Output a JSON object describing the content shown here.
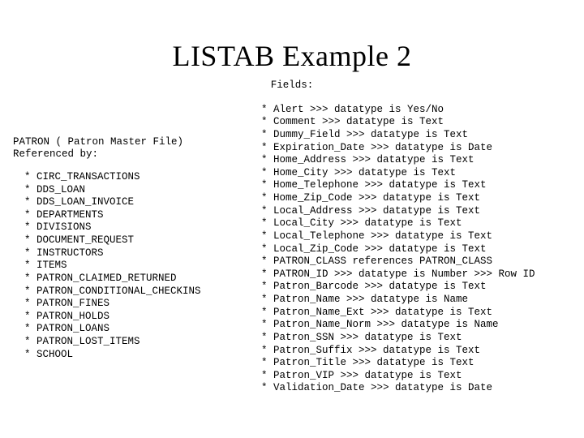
{
  "title": "LISTAB Example 2",
  "fields_label": "Fields:",
  "left": {
    "header_line1": "PATRON ( Patron Master File)",
    "header_line2": "Referenced by:",
    "items": [
      "CIRC_TRANSACTIONS",
      "DDS_LOAN",
      "DDS_LOAN_INVOICE",
      "DEPARTMENTS",
      "DIVISIONS",
      "DOCUMENT_REQUEST",
      "INSTRUCTORS",
      "ITEMS",
      "PATRON_CLAIMED_RETURNED",
      "PATRON_CONDITIONAL_CHECKINS",
      "PATRON_FINES",
      "PATRON_HOLDS",
      "PATRON_LOANS",
      "PATRON_LOST_ITEMS",
      "SCHOOL"
    ]
  },
  "right": {
    "items": [
      "Alert >>> datatype is Yes/No",
      "Comment >>> datatype is Text",
      "Dummy_Field >>> datatype is Text",
      "Expiration_Date >>> datatype is Date",
      "Home_Address >>> datatype is Text",
      "Home_City >>> datatype is Text",
      "Home_Telephone >>> datatype is Text",
      "Home_Zip_Code >>> datatype is Text",
      "Local_Address >>> datatype is Text",
      "Local_City >>> datatype is Text",
      "Local_Telephone >>> datatype is Text",
      "Local_Zip_Code >>> datatype is Text",
      "PATRON_CLASS references PATRON_CLASS",
      "PATRON_ID >>> datatype is Number >>> Row ID",
      "Patron_Barcode >>> datatype is Text",
      "Patron_Name >>> datatype is Name",
      "Patron_Name_Ext >>> datatype is Text",
      "Patron_Name_Norm >>> datatype is Name",
      "Patron_SSN >>> datatype is Text",
      "Patron_Suffix >>> datatype is Text",
      "Patron_Title >>> datatype is Text",
      "Patron_VIP >>> datatype is Text",
      "Validation_Date >>> datatype is Date"
    ]
  }
}
